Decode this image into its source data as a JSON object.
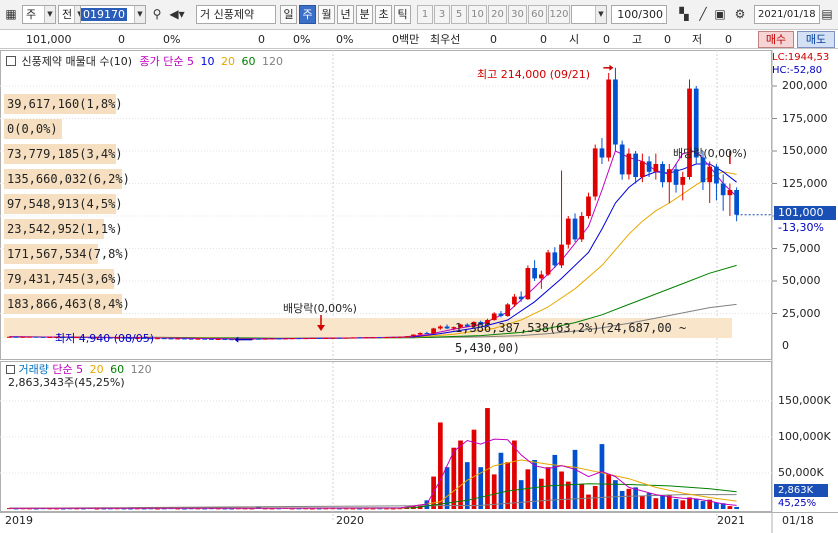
{
  "toolbar": {
    "market_sel": "주",
    "type_sel": "전",
    "code": "019170",
    "name_sel": "거",
    "stock_name": "신풍제약",
    "periods": [
      "일",
      "주",
      "월",
      "년",
      "분",
      "초",
      "틱"
    ],
    "active_period": "주",
    "numbers": [
      "1",
      "3",
      "5",
      "10",
      "20",
      "30",
      "60",
      "120"
    ],
    "count": "100",
    "count_total": "/300",
    "date": "2021/01/18"
  },
  "infobar": {
    "price": "101,000",
    "v1": "0",
    "v2": "0%",
    "v3": "0",
    "v4": "0%",
    "v5": "0%",
    "amount": "0백만",
    "best_label": "최우선",
    "best1": "0",
    "best2": "0",
    "open_label": "시",
    "open": "0",
    "high_label": "고",
    "high": "0",
    "low_label": "저",
    "low": "0",
    "buy": "매수",
    "sell": "매도"
  },
  "legend": {
    "title": "신풍제약 매물대 수(10)",
    "ma_label": "종가 단순",
    "ma_periods": [
      "5",
      "10",
      "20",
      "60",
      "120"
    ],
    "ma_colors": [
      "#c000c0",
      "#0000e0",
      "#e6a800",
      "#008000",
      "#808080"
    ]
  },
  "volume_profile": [
    "39,617,160(1,8%)",
    "0(0,0%)",
    "73,779,185(3,4%)",
    "135,660,032(6,2%)",
    "97,548,913(4,5%)",
    "23,542,952(1,1%)",
    "171,567,534(7,8%)",
    "79,431,745(3,6%)",
    "183,866,463(8,4%)",
    "1,386,387,538(63,2%)(24,687,00 ~ 5,430,00)"
  ],
  "annotations": {
    "max": "최고 214,000 (09/21)",
    "min": "최저 4,940 (08/05)",
    "div1": "배당락(0,00%)",
    "div2": "배당락(0,00%)"
  },
  "price_axis": {
    "lc": "LC:1944,53",
    "hc": "HC:-52,80",
    "ticks": [
      "200,000",
      "175,000",
      "150,000",
      "125,000",
      "100,000",
      "75,000",
      "50,000",
      "25,000",
      "0"
    ],
    "current": "101,000",
    "change": "-13,30%"
  },
  "volume_legend": {
    "label": "거래량",
    "ma_label": "단순",
    "ma_periods": [
      "5",
      "20",
      "60",
      "120"
    ],
    "current": "2,863,343주(45,25%)"
  },
  "volume_axis": {
    "ticks": [
      "150,000K",
      "100,000K",
      "50,000K"
    ],
    "current": "2,863K",
    "pct": "45,25%"
  },
  "time_axis": {
    "labels": [
      "2019",
      "2020",
      "2021"
    ],
    "last": "01/18"
  },
  "chart_data": {
    "type": "candlestick",
    "title": "신풍제약",
    "y_unit": "KRW",
    "ylim": [
      0,
      220000
    ],
    "candles": [
      [
        7000,
        7200,
        6800,
        7100
      ],
      [
        7100,
        7300,
        6900,
        7000
      ],
      [
        7000,
        7200,
        6800,
        7050
      ],
      [
        7050,
        7250,
        6900,
        7150
      ],
      [
        7150,
        7300,
        6950,
        7000
      ],
      [
        7000,
        7100,
        6700,
        6800
      ],
      [
        6800,
        7000,
        6600,
        6900
      ],
      [
        6900,
        7100,
        6700,
        6950
      ],
      [
        6950,
        7100,
        6750,
        6850
      ],
      [
        6850,
        7000,
        6600,
        6700
      ],
      [
        6700,
        6900,
        6500,
        6800
      ],
      [
        6800,
        6950,
        6600,
        6650
      ],
      [
        6650,
        6800,
        6400,
        6500
      ],
      [
        6500,
        6700,
        6300,
        6600
      ],
      [
        6600,
        6800,
        6400,
        6450
      ],
      [
        6450,
        6600,
        6200,
        6300
      ],
      [
        6300,
        6500,
        6100,
        6400
      ],
      [
        6400,
        6600,
        6200,
        6250
      ],
      [
        6250,
        6400,
        6000,
        6100
      ],
      [
        6100,
        6300,
        5900,
        6200
      ],
      [
        6200,
        6400,
        6000,
        6050
      ],
      [
        6050,
        6200,
        5800,
        5900
      ],
      [
        5900,
        6100,
        5700,
        6000
      ],
      [
        6000,
        6200,
        5800,
        5850
      ],
      [
        5850,
        6000,
        5600,
        5700
      ],
      [
        5700,
        5900,
        5500,
        5800
      ],
      [
        5800,
        6000,
        5600,
        5650
      ],
      [
        5650,
        5800,
        5400,
        5500
      ],
      [
        5500,
        5700,
        5300,
        5600
      ],
      [
        5600,
        5800,
        5400,
        5450
      ],
      [
        5450,
        5600,
        5200,
        5300
      ],
      [
        5300,
        5500,
        5100,
        5400
      ],
      [
        5400,
        5600,
        5200,
        5250
      ],
      [
        5250,
        5400,
        5000,
        5100
      ],
      [
        5100,
        5300,
        4940,
        5200
      ],
      [
        5200,
        5500,
        5100,
        5450
      ],
      [
        5450,
        5700,
        5300,
        5600
      ],
      [
        5600,
        5800,
        5400,
        5500
      ],
      [
        5500,
        5700,
        5300,
        5650
      ],
      [
        5650,
        5900,
        5500,
        5800
      ],
      [
        5800,
        6000,
        5600,
        5700
      ],
      [
        5700,
        5900,
        5500,
        5850
      ],
      [
        5850,
        6100,
        5700,
        6000
      ],
      [
        6000,
        6200,
        5800,
        5900
      ],
      [
        5900,
        6100,
        5700,
        6050
      ],
      [
        6050,
        6300,
        5900,
        6200
      ],
      [
        6200,
        6400,
        6000,
        6100
      ],
      [
        6100,
        6300,
        5900,
        6250
      ],
      [
        6250,
        6500,
        6100,
        6400
      ],
      [
        6400,
        6600,
        6200,
        6300
      ],
      [
        6300,
        6500,
        6100,
        6450
      ],
      [
        6450,
        6700,
        6300,
        6600
      ],
      [
        6600,
        6800,
        6400,
        6500
      ],
      [
        6500,
        6700,
        6300,
        6650
      ],
      [
        6650,
        6900,
        6500,
        6800
      ],
      [
        6800,
        7000,
        6600,
        6700
      ],
      [
        6700,
        6900,
        6500,
        6850
      ],
      [
        6850,
        7100,
        6700,
        7000
      ],
      [
        7000,
        7300,
        6800,
        7200
      ],
      [
        7200,
        7500,
        7000,
        7400
      ],
      [
        7400,
        9000,
        7300,
        8800
      ],
      [
        8800,
        10500,
        8500,
        10000
      ],
      [
        10000,
        11000,
        9200,
        9500
      ],
      [
        9500,
        14000,
        9400,
        13500
      ],
      [
        13500,
        16000,
        12500,
        15000
      ],
      [
        15000,
        16500,
        13000,
        13500
      ],
      [
        13500,
        15000,
        12000,
        14500
      ],
      [
        14500,
        17000,
        13800,
        16500
      ],
      [
        16500,
        17500,
        14500,
        15000
      ],
      [
        15000,
        19000,
        14800,
        18500
      ],
      [
        18500,
        19500,
        16000,
        16500
      ],
      [
        16500,
        21000,
        16000,
        20000
      ],
      [
        20000,
        26000,
        19500,
        25000
      ],
      [
        25000,
        27000,
        22000,
        23000
      ],
      [
        23000,
        33000,
        22500,
        32000
      ],
      [
        32000,
        40000,
        30000,
        38000
      ],
      [
        38000,
        42000,
        34000,
        36000
      ],
      [
        36000,
        62000,
        35500,
        60000
      ],
      [
        60000,
        66000,
        50000,
        52000
      ],
      [
        52000,
        58000,
        44000,
        55000
      ],
      [
        55000,
        74000,
        54000,
        72000
      ],
      [
        72000,
        76000,
        60000,
        62000
      ],
      [
        62000,
        135000,
        60000,
        78000
      ],
      [
        78000,
        100000,
        75000,
        98000
      ],
      [
        98000,
        102000,
        80000,
        82000
      ],
      [
        82000,
        103000,
        80000,
        100000
      ],
      [
        100000,
        118000,
        98000,
        115000
      ],
      [
        115000,
        155000,
        112000,
        152000
      ],
      [
        152000,
        160000,
        140000,
        145000
      ],
      [
        145000,
        210000,
        142000,
        205000
      ],
      [
        205000,
        214000,
        150000,
        155000
      ],
      [
        155000,
        158000,
        128000,
        132000
      ],
      [
        132000,
        152000,
        128000,
        148000
      ],
      [
        148000,
        150000,
        125000,
        130000
      ],
      [
        130000,
        148000,
        126000,
        142000
      ],
      [
        142000,
        146000,
        130000,
        134000
      ],
      [
        134000,
        148000,
        128000,
        140000
      ],
      [
        140000,
        142000,
        122000,
        126000
      ],
      [
        126000,
        140000,
        110000,
        136000
      ],
      [
        136000,
        140000,
        118000,
        124000
      ],
      [
        124000,
        134000,
        112000,
        130000
      ],
      [
        130000,
        205000,
        128000,
        198000
      ],
      [
        198000,
        200000,
        140000,
        145000
      ],
      [
        145000,
        150000,
        120000,
        126000
      ],
      [
        126000,
        142000,
        110000,
        138000
      ],
      [
        138000,
        140000,
        112000,
        125000
      ],
      [
        125000,
        132000,
        104000,
        116000
      ],
      [
        116000,
        125000,
        100000,
        120000
      ],
      [
        120000,
        122000,
        96000,
        101000
      ]
    ],
    "ma5": [
      [
        0,
        7050
      ],
      [
        10,
        6780
      ],
      [
        20,
        6250
      ],
      [
        30,
        5700
      ],
      [
        34,
        5300
      ],
      [
        40,
        5620
      ],
      [
        50,
        6150
      ],
      [
        58,
        6720
      ],
      [
        62,
        8600
      ],
      [
        66,
        13000
      ],
      [
        70,
        16500
      ],
      [
        74,
        26000
      ],
      [
        78,
        45000
      ],
      [
        82,
        66000
      ],
      [
        86,
        92000
      ],
      [
        88,
        120000
      ],
      [
        90,
        150000
      ],
      [
        92,
        145000
      ],
      [
        94,
        142000
      ],
      [
        96,
        135000
      ],
      [
        98,
        132000
      ],
      [
        100,
        148000
      ],
      [
        102,
        150000
      ],
      [
        104,
        138000
      ],
      [
        106,
        125000
      ],
      [
        108,
        115000
      ]
    ],
    "ma10": [
      [
        0,
        7100
      ],
      [
        20,
        6400
      ],
      [
        34,
        5500
      ],
      [
        50,
        6100
      ],
      [
        60,
        6900
      ],
      [
        64,
        9500
      ],
      [
        70,
        14500
      ],
      [
        74,
        20000
      ],
      [
        78,
        34000
      ],
      [
        82,
        52000
      ],
      [
        86,
        72000
      ],
      [
        88,
        90000
      ],
      [
        90,
        110000
      ],
      [
        92,
        122000
      ],
      [
        94,
        130000
      ],
      [
        96,
        134000
      ],
      [
        98,
        133000
      ],
      [
        100,
        136000
      ],
      [
        102,
        140000
      ],
      [
        104,
        140000
      ],
      [
        106,
        134000
      ],
      [
        108,
        126000
      ]
    ],
    "ma20": [
      [
        0,
        7100
      ],
      [
        20,
        6600
      ],
      [
        34,
        5800
      ],
      [
        50,
        6000
      ],
      [
        60,
        6600
      ],
      [
        66,
        9000
      ],
      [
        72,
        13500
      ],
      [
        76,
        20000
      ],
      [
        80,
        30000
      ],
      [
        84,
        44000
      ],
      [
        88,
        62000
      ],
      [
        90,
        74000
      ],
      [
        92,
        86000
      ],
      [
        94,
        96000
      ],
      [
        96,
        104000
      ],
      [
        98,
        110000
      ],
      [
        100,
        117000
      ],
      [
        102,
        124000
      ],
      [
        104,
        130000
      ],
      [
        106,
        134000
      ],
      [
        108,
        132000
      ]
    ],
    "ma60": [
      [
        20,
        6800
      ],
      [
        40,
        6000
      ],
      [
        60,
        6400
      ],
      [
        70,
        8000
      ],
      [
        76,
        10500
      ],
      [
        80,
        13500
      ],
      [
        84,
        18000
      ],
      [
        88,
        24000
      ],
      [
        92,
        32000
      ],
      [
        96,
        40000
      ],
      [
        100,
        48000
      ],
      [
        104,
        56000
      ],
      [
        108,
        62000
      ]
    ],
    "ma120": [
      [
        60,
        6500
      ],
      [
        70,
        7000
      ],
      [
        76,
        8000
      ],
      [
        80,
        9500
      ],
      [
        84,
        11500
      ],
      [
        88,
        14000
      ],
      [
        92,
        17500
      ],
      [
        96,
        21500
      ],
      [
        100,
        25500
      ],
      [
        104,
        29500
      ],
      [
        108,
        32000
      ]
    ],
    "volume": [
      1200,
      800,
      1000,
      900,
      700,
      1100,
      900,
      800,
      700,
      1000,
      900,
      800,
      1300,
      700,
      800,
      900,
      1000,
      800,
      700,
      900,
      800,
      1000,
      700,
      900,
      1200,
      800,
      700,
      1000,
      900,
      800,
      1100,
      900,
      800,
      700,
      1000,
      900,
      800,
      3500,
      900,
      800,
      1000,
      1400,
      800,
      900,
      1000,
      700,
      800,
      900,
      1100,
      800,
      900,
      800,
      700,
      900,
      800,
      1000,
      900,
      800,
      1100,
      2500,
      4000,
      6000,
      12000,
      45000,
      120000,
      58000,
      85000,
      95000,
      65000,
      110000,
      58000,
      140000,
      48000,
      78000,
      65000,
      95000,
      40000,
      55000,
      68000,
      42000,
      58000,
      75000,
      52000,
      38000,
      82000,
      35000,
      20000,
      32000,
      90000,
      48000,
      40000,
      25000,
      28000,
      30000,
      18000,
      22000,
      15000,
      18000,
      20000,
      14000,
      12000,
      16000,
      14000,
      11000,
      13000,
      9000,
      8000,
      4000,
      2863
    ],
    "volume_ylim": [
      0,
      190000
    ],
    "vol_ma5": [
      [
        0,
        950
      ],
      [
        40,
        950
      ],
      [
        58,
        1400
      ],
      [
        62,
        7000
      ],
      [
        64,
        40000
      ],
      [
        66,
        80000
      ],
      [
        68,
        95000
      ],
      [
        70,
        90000
      ],
      [
        72,
        97000
      ],
      [
        74,
        96000
      ],
      [
        76,
        75000
      ],
      [
        78,
        60000
      ],
      [
        80,
        56000
      ],
      [
        82,
        60000
      ],
      [
        84,
        55000
      ],
      [
        86,
        45000
      ],
      [
        88,
        52000
      ],
      [
        90,
        45000
      ],
      [
        92,
        30000
      ],
      [
        94,
        25000
      ],
      [
        96,
        20000
      ],
      [
        98,
        17000
      ],
      [
        100,
        15000
      ],
      [
        102,
        14000
      ],
      [
        104,
        11000
      ],
      [
        106,
        7000
      ],
      [
        108,
        5000
      ]
    ],
    "vol_ma20": [
      [
        0,
        950
      ],
      [
        58,
        1100
      ],
      [
        64,
        10000
      ],
      [
        68,
        40000
      ],
      [
        72,
        60000
      ],
      [
        76,
        68000
      ],
      [
        80,
        62000
      ],
      [
        84,
        58000
      ],
      [
        88,
        50000
      ],
      [
        92,
        42000
      ],
      [
        96,
        30000
      ],
      [
        100,
        22000
      ],
      [
        104,
        16000
      ],
      [
        108,
        11000
      ]
    ],
    "vol_ma60": [
      [
        0,
        950
      ],
      [
        60,
        1500
      ],
      [
        68,
        12000
      ],
      [
        74,
        25000
      ],
      [
        80,
        32000
      ],
      [
        86,
        35000
      ],
      [
        92,
        34000
      ],
      [
        98,
        32000
      ],
      [
        104,
        28000
      ],
      [
        108,
        24000
      ]
    ],
    "vol_ma120": [
      [
        0,
        950
      ],
      [
        70,
        5000
      ],
      [
        80,
        12000
      ],
      [
        90,
        17000
      ],
      [
        100,
        20000
      ],
      [
        108,
        20000
      ]
    ]
  }
}
